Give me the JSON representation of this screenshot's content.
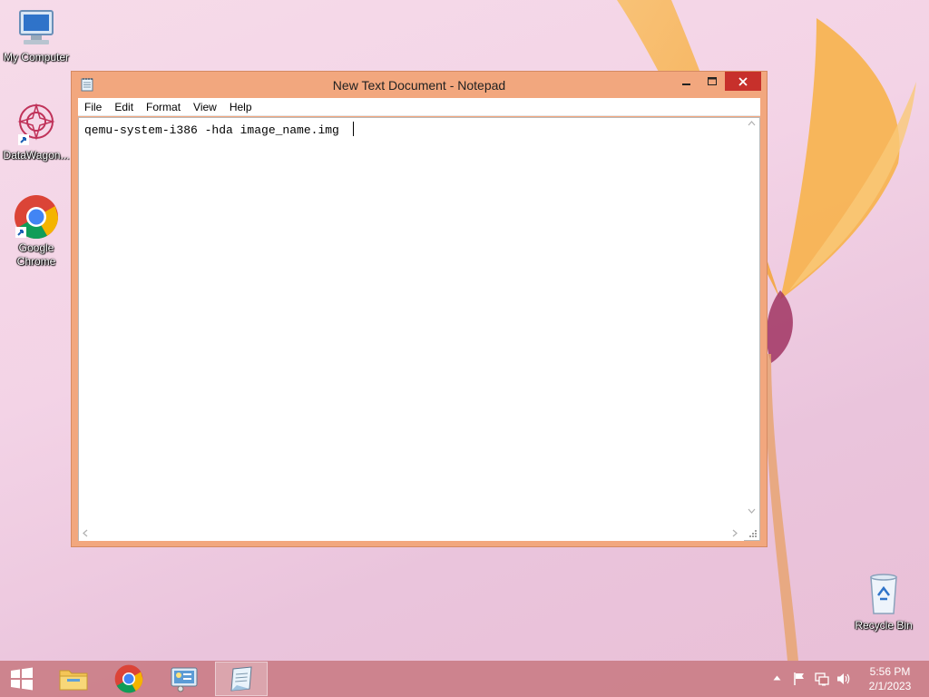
{
  "desktop": {
    "icons": [
      {
        "label": "My Computer"
      },
      {
        "label": "DataWagon..."
      },
      {
        "label": "Google Chrome"
      },
      {
        "label": "Recycle Bin"
      }
    ]
  },
  "window": {
    "title": "New Text Document - Notepad",
    "menu": [
      "File",
      "Edit",
      "Format",
      "View",
      "Help"
    ],
    "content": "qemu-system-i386 -hda image_name.img "
  },
  "taskbar": {
    "time": "5:56 PM",
    "date": "2/1/2023"
  },
  "colors": {
    "window_frame": "#f2a77e",
    "close_button": "#c7302b",
    "taskbar": "#c8787f"
  }
}
